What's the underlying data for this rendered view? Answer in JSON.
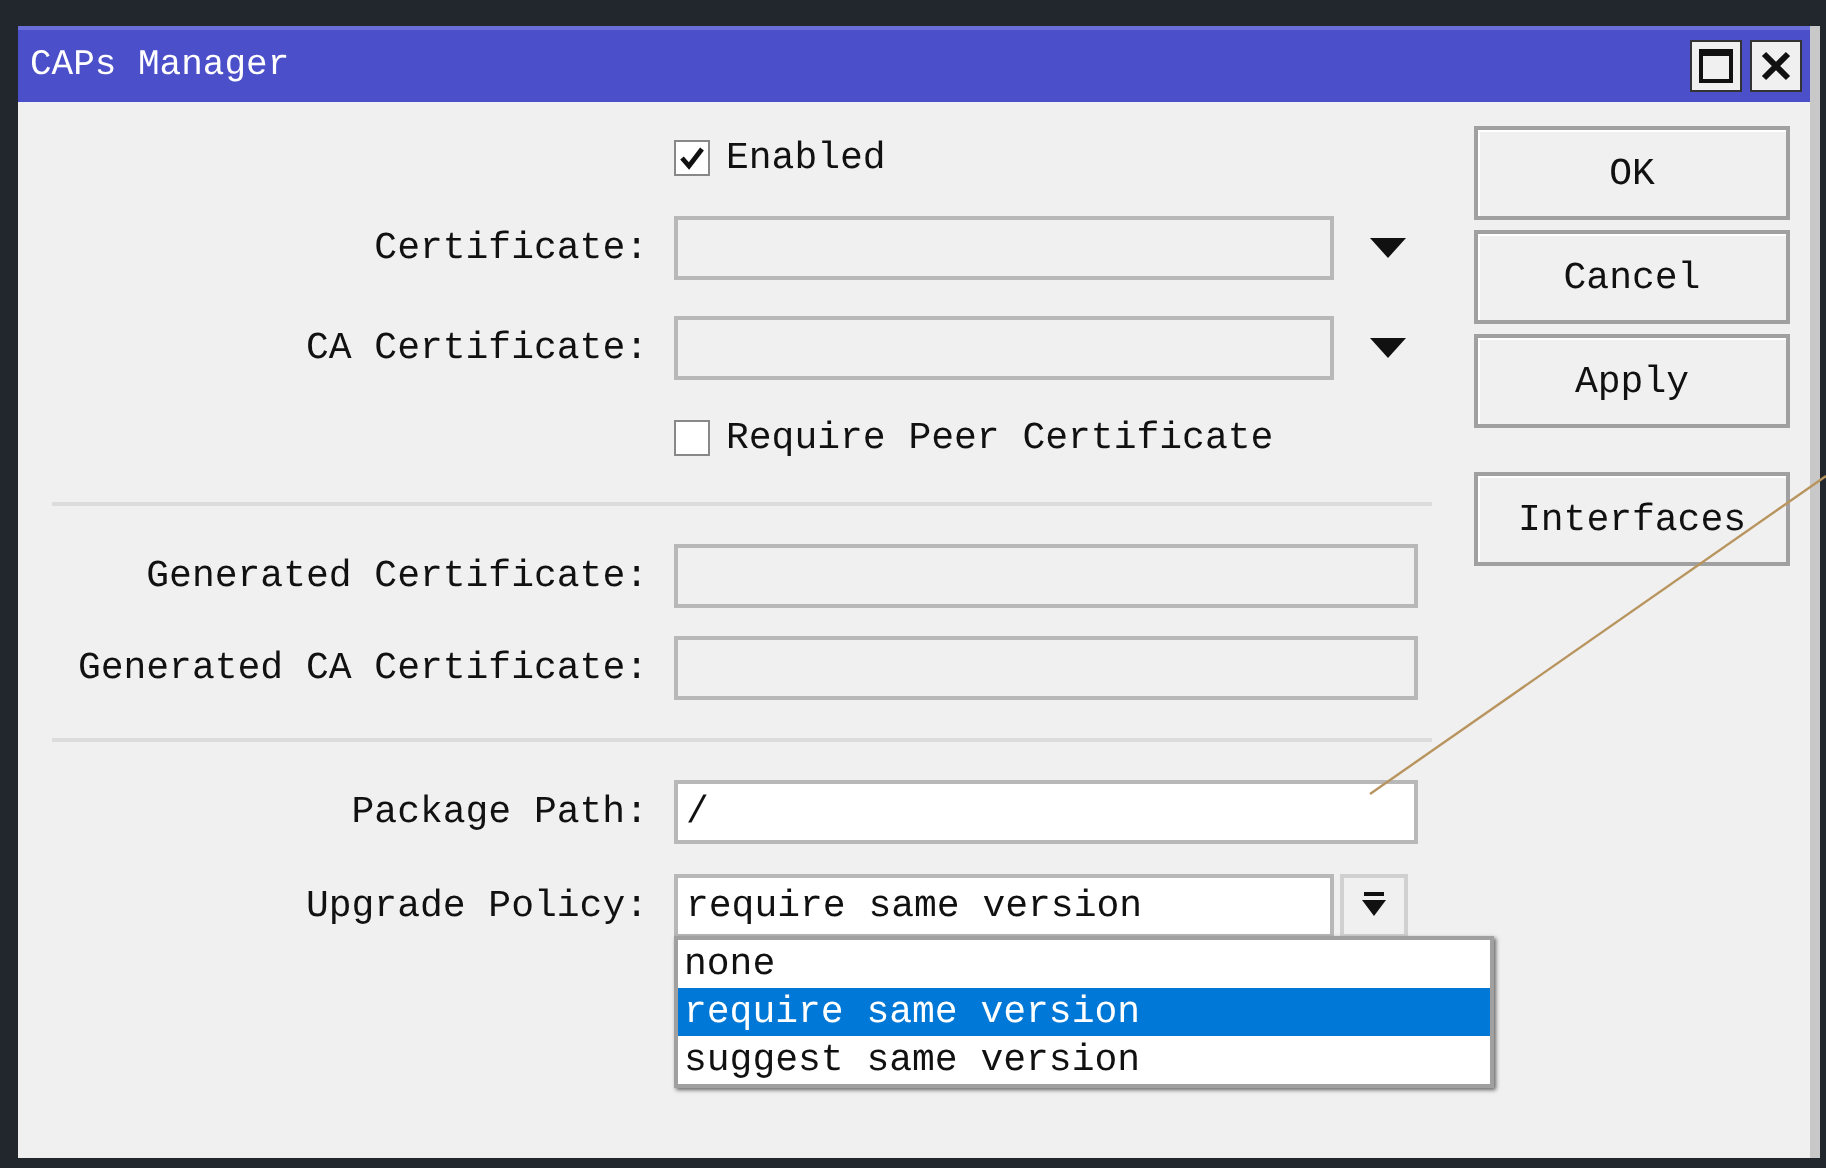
{
  "window": {
    "title": "CAPs Manager"
  },
  "rows": [
    {
      "kind": "checkbox",
      "label": "Enabled",
      "checked": true
    },
    {
      "kind": "select",
      "label": "Certificate:"
    },
    {
      "kind": "select",
      "label": "CA Certificate:"
    },
    {
      "kind": "checkbox",
      "label": "Require Peer Certificate",
      "checked": false
    },
    {
      "kind": "divider"
    },
    {
      "kind": "readonly",
      "label": "Generated Certificate:"
    },
    {
      "kind": "readonly",
      "label": "Generated CA Certificate:"
    },
    {
      "kind": "divider"
    },
    {
      "kind": "text",
      "label": "Package Path:",
      "value": "/"
    },
    {
      "kind": "dropdown",
      "label": "Upgrade Policy:",
      "value": "require same version",
      "expanded": true,
      "options": [
        {
          "label": "none",
          "selected": false
        },
        {
          "label": "require same version",
          "selected": true
        },
        {
          "label": "suggest same version",
          "selected": false
        }
      ]
    }
  ],
  "buttons": [
    "OK",
    "Cancel",
    "Apply",
    "Interfaces"
  ]
}
